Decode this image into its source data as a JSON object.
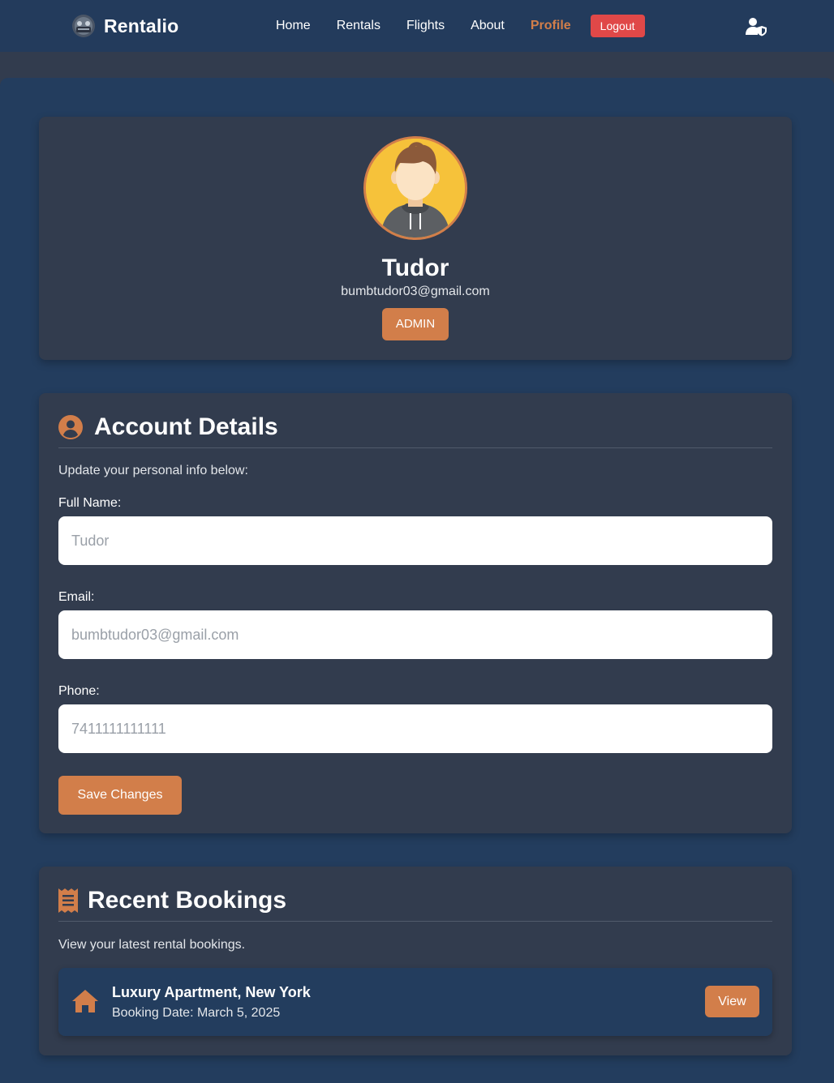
{
  "nav": {
    "brand": "Rentalio",
    "links": [
      "Home",
      "Rentals",
      "Flights",
      "About",
      "Profile"
    ],
    "active_link": "Profile",
    "logout_label": "Logout",
    "user_icon": "user-shield-icon"
  },
  "profile": {
    "name": "Tudor",
    "email": "bumbtudor03@gmail.com",
    "role": "ADMIN"
  },
  "account": {
    "title": "Account Details",
    "subtitle": "Update your personal info below:",
    "fields": {
      "full_name": {
        "label": "Full Name:",
        "placeholder": "Tudor"
      },
      "email": {
        "label": "Email:",
        "placeholder": "bumbtudor03@gmail.com"
      },
      "phone": {
        "label": "Phone:",
        "placeholder": "7411111111111"
      }
    },
    "save_label": "Save Changes"
  },
  "bookings": {
    "title": "Recent Bookings",
    "subtitle": "View your latest rental bookings.",
    "items": [
      {
        "title": "Luxury Apartment, New York",
        "date": "Booking Date: March 5, 2025",
        "view_label": "View"
      }
    ]
  },
  "colors": {
    "accent": "#d27e4a",
    "navbar": "#233b5c",
    "card": "#323c4e",
    "logout": "#e04848"
  }
}
